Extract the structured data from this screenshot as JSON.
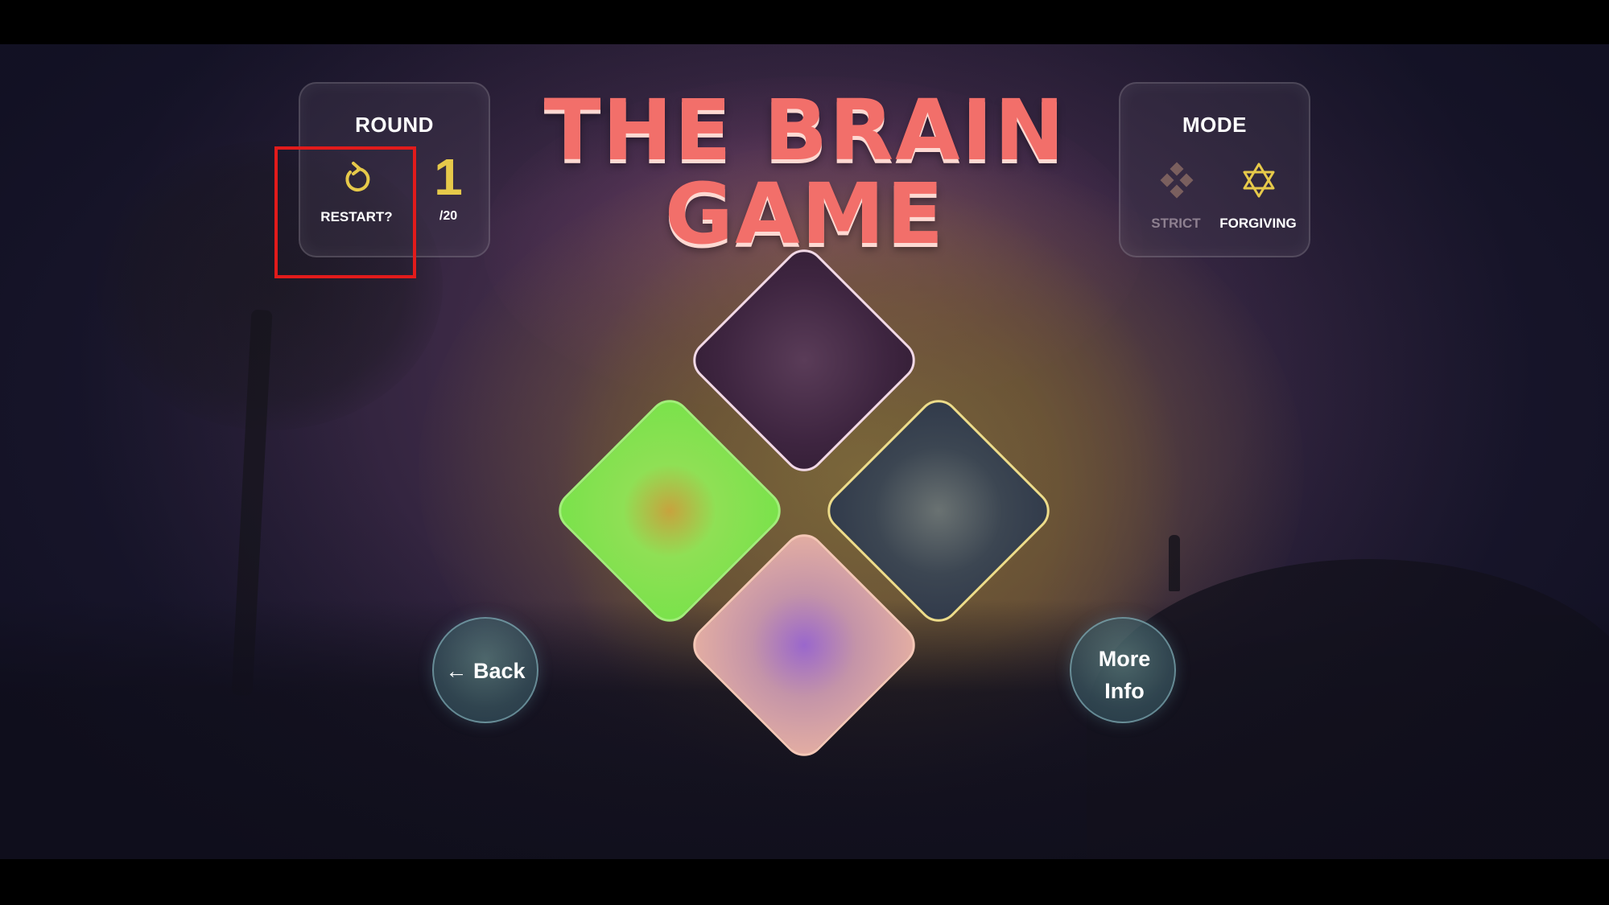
{
  "title": {
    "line1": "THE BRAIN",
    "line2": "GAME"
  },
  "round_panel": {
    "heading": "ROUND",
    "restart_label": "RESTART?",
    "restart_icon": "restart-arrow-icon",
    "current_round": "1",
    "total_rounds": "/20"
  },
  "mode_panel": {
    "heading": "MODE",
    "options": [
      {
        "label": "STRICT",
        "icon": "diamond-cluster-icon",
        "selected": false
      },
      {
        "label": "FORGIVING",
        "icon": "star-of-david-icon",
        "selected": true
      }
    ]
  },
  "buttons": {
    "back": "← Back",
    "more_info": "More Info"
  },
  "tiles": [
    {
      "position": "top",
      "color": "#3e2540"
    },
    {
      "position": "left",
      "color": "#78e24a"
    },
    {
      "position": "right",
      "color": "#3c4652"
    },
    {
      "position": "bottom",
      "color": "#c494a8"
    }
  ],
  "colors": {
    "title": "#f26f6a",
    "accent_yellow": "#e6c94a",
    "highlight_box": "#e21b1b"
  }
}
